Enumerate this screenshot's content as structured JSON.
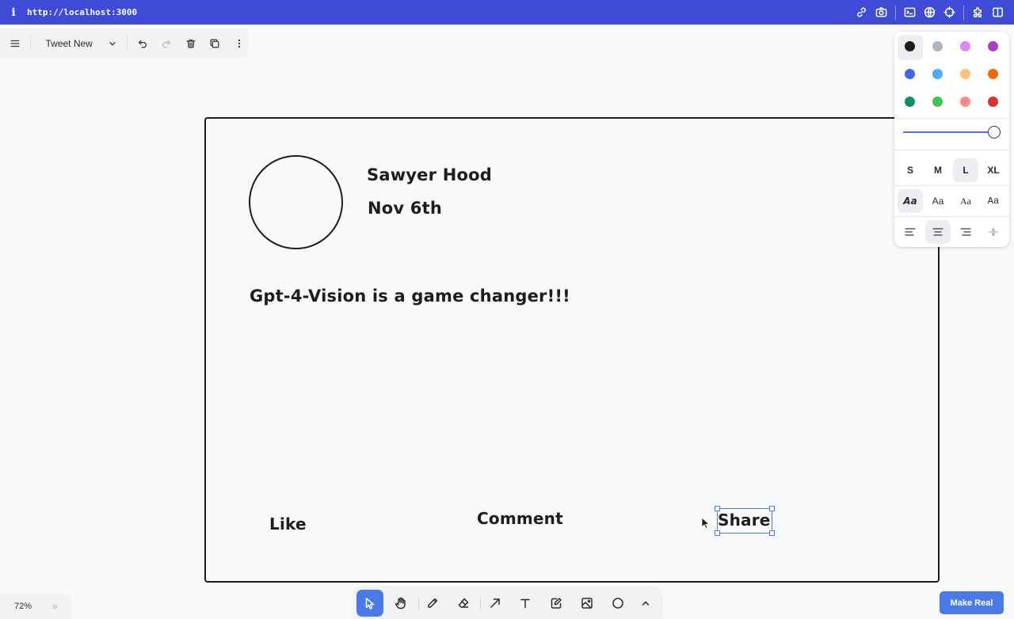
{
  "browser": {
    "info_icon": "i",
    "url": "http://localhost:3000",
    "icons": [
      "link-icon",
      "camera-icon",
      "terminal-icon",
      "globe-icon",
      "crosshair-icon",
      "extension-icon",
      "split-view-icon"
    ]
  },
  "menu": {
    "page_name": "Tweet New",
    "icons": [
      "hamburger-icon",
      "chevron-down-icon",
      "undo-icon",
      "redo-icon",
      "trash-icon",
      "duplicate-icon",
      "more-icon"
    ]
  },
  "canvas": {
    "name": "Sawyer Hood",
    "date": "Nov 6th",
    "tweet": "Gpt-4-Vision is a game changer!!!",
    "like": "Like",
    "comment": "Comment",
    "share": "Share"
  },
  "style_panel": {
    "colors": [
      "#1d1d1d",
      "#adb5bd",
      "#e085f4",
      "#ae3ec9",
      "#4263eb",
      "#4dabf7",
      "#ffc078",
      "#f76707",
      "#099268",
      "#40c057",
      "#ff8787",
      "#e03131"
    ],
    "selected_color": "#1d1d1d",
    "opacity": 1.0,
    "sizes": [
      "S",
      "M",
      "L",
      "XL"
    ],
    "selected_size": "L",
    "fonts": [
      "Aa",
      "Aa",
      "Aa",
      "Aa"
    ],
    "selected_font_index": 0,
    "align_icons": [
      "align-left-icon",
      "align-center-icon",
      "align-right-icon",
      "vertical-align-icon"
    ],
    "selected_align": "align-center-icon"
  },
  "zoom": {
    "level": "72%",
    "expand_icon": "»"
  },
  "toolbar": {
    "tools": [
      "select-icon",
      "hand-icon",
      "pencil-icon",
      "eraser-icon",
      "arrow-icon",
      "text-icon",
      "note-icon",
      "image-icon",
      "ellipse-icon",
      "chevron-up-icon"
    ],
    "active_tool": "select-icon"
  },
  "make_real": {
    "label": "Make Real"
  }
}
